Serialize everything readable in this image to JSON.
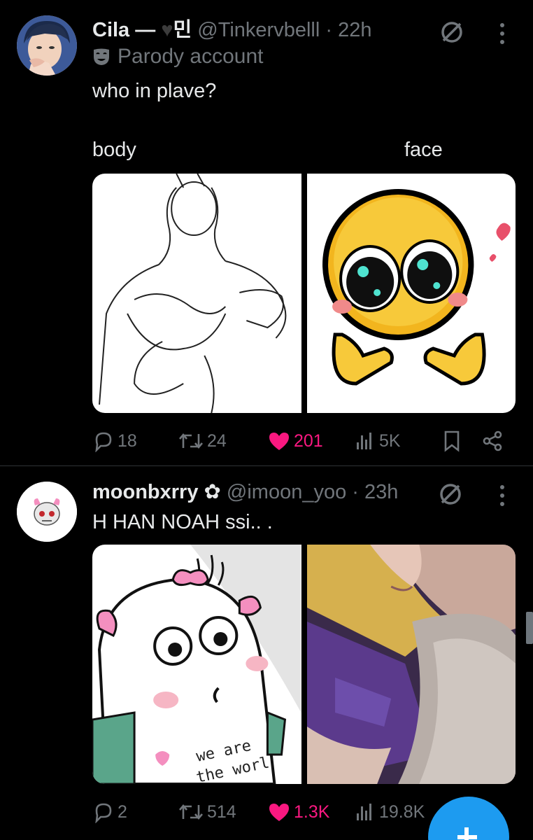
{
  "tweets": [
    {
      "display_name": "Cila — ",
      "name_suffix": "민",
      "handle": "@Tinkervbelll",
      "dot": " · ",
      "time": "22h",
      "parody_label": "Parody account",
      "text": "who in plave?",
      "media_labels": {
        "left": "body",
        "right": "face"
      },
      "stats": {
        "replies": "18",
        "reposts": "24",
        "likes": "201",
        "views": "5K"
      },
      "liked": true
    },
    {
      "display_name": "moonbxrry",
      "handle": "@imoon_yoo",
      "dot": " · ",
      "time": "23h",
      "text": "H HAN NOAH ssi.. .",
      "sticker_text": "we are",
      "sticker_text2": "the worl",
      "stats": {
        "replies": "2",
        "reposts": "514",
        "likes": "1.3K",
        "views": "19.8K"
      },
      "liked": true
    }
  ],
  "icons": {
    "reply": "reply-icon",
    "repost": "repost-icon",
    "like": "heart-icon",
    "views": "views-icon",
    "bookmark": "bookmark-icon",
    "share": "share-icon",
    "grok": "grok-icon",
    "more": "more-icon",
    "compose": "compose-plus-icon"
  },
  "colors": {
    "background": "#000000",
    "text": "#e7e9ea",
    "secondary": "#71767b",
    "like": "#f91880",
    "accent": "#1d9bf0"
  }
}
